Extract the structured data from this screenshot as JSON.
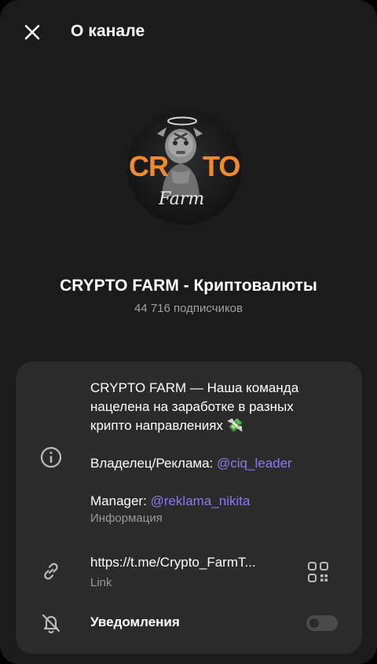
{
  "header": {
    "title": "О канале"
  },
  "channel": {
    "name": "CRYPTO FARM - Криптовалюты",
    "subscribers": "44 716 подписчиков",
    "avatar_logo_text": "CRYPTO Farm"
  },
  "info": {
    "description_lines": [
      "CRYPTO FARM — Наша команда",
      "нацелена на заработке в разных",
      "крипто направлениях 💸"
    ],
    "owner_label": "Владелец/Реклама:",
    "owner_mention": "@ciq_leader",
    "manager_label": "Manager:",
    "manager_mention": "@reklama_nikita",
    "section_label": "Информация"
  },
  "link": {
    "url": "https://t.me/Crypto_FarmT...",
    "label": "Link"
  },
  "notifications": {
    "label": "Уведомления",
    "enabled": false
  },
  "colors": {
    "background": "#1b1b1b",
    "card": "#2b2b2b",
    "accent_link": "#8a7cf0",
    "secondary_text": "#a0a0a0",
    "logo_orange": "#f08a2c"
  },
  "icons": {
    "close": "close-icon",
    "info": "info-icon",
    "link": "link-icon",
    "qr": "qr-code-icon",
    "notifications": "bell-off-icon"
  }
}
